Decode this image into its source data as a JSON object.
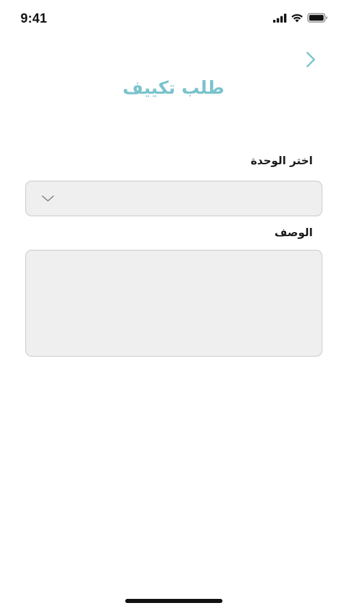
{
  "status_bar": {
    "time": "9:41",
    "icons": [
      "signal-icon",
      "wifi-icon",
      "battery-icon"
    ]
  },
  "header": {
    "title": "طلب تكييف",
    "back_icon": "chevron-right-icon"
  },
  "form": {
    "unit_label": "اختر الوحدة",
    "unit_selected_value": "",
    "description_label": "الوصف",
    "description_value": ""
  },
  "colors": {
    "accent": "#7ac3cd",
    "field_bg": "#efefef",
    "field_border": "#c9c9c9",
    "text": "#1d1d1d"
  }
}
